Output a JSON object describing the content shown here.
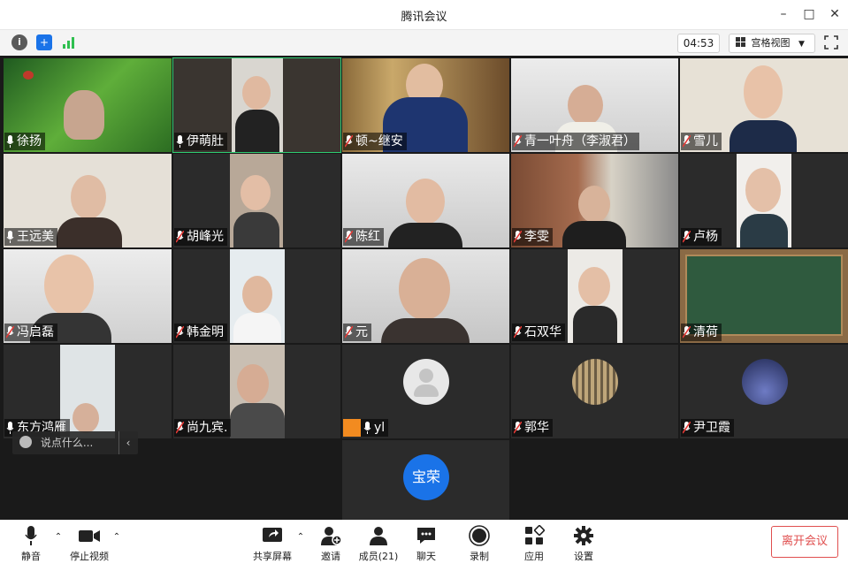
{
  "window": {
    "title": "腾讯会议"
  },
  "toolbar": {
    "timer": "04:53",
    "view_mode": "宫格视图"
  },
  "participants": [
    {
      "name": "徐扬"
    },
    {
      "name": "伊萌肚"
    },
    {
      "name": "顿~继安"
    },
    {
      "name": "青一叶舟（李淑君）"
    },
    {
      "name": "雪儿"
    },
    {
      "name": "王远美"
    },
    {
      "name": "胡峰光"
    },
    {
      "name": "陈红"
    },
    {
      "name": "李雯"
    },
    {
      "name": "卢杨"
    },
    {
      "name": "冯启磊"
    },
    {
      "name": "韩金明"
    },
    {
      "name": "元"
    },
    {
      "name": "石双华"
    },
    {
      "name": "清荷"
    },
    {
      "name": "东方鸿雁"
    },
    {
      "name": "尚九宾."
    },
    {
      "name": "yl"
    },
    {
      "name": "郭华"
    },
    {
      "name": "尹卫霞"
    },
    {
      "name": "宝荣"
    }
  ],
  "chat": {
    "placeholder": "说点什么..."
  },
  "bottom": {
    "mute": "静音",
    "stop_video": "停止视频",
    "share_screen": "共享屏幕",
    "invite": "邀请",
    "members": "成员(21)",
    "chat": "聊天",
    "record": "录制",
    "apps": "应用",
    "settings": "设置",
    "leave": "离开会议"
  },
  "colors": {
    "active_border": "#2ecc71",
    "leave_red": "#e04f4f",
    "avatar_blue": "#1a73e8"
  }
}
